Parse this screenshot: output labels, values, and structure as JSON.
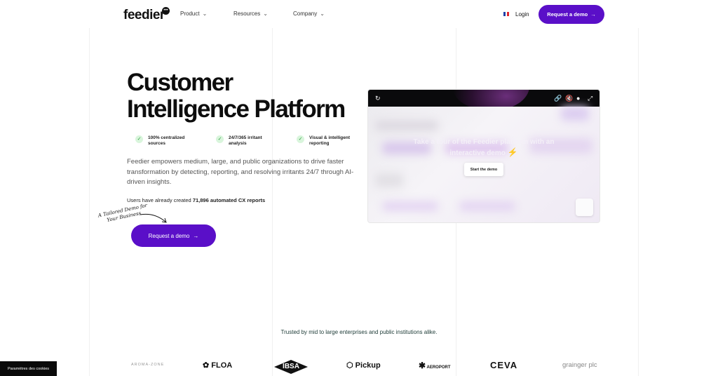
{
  "nav": {
    "logo": "feedier",
    "logo_badge": "•••",
    "items": [
      {
        "label": "Product"
      },
      {
        "label": "Resources"
      },
      {
        "label": "Company"
      }
    ],
    "login": "Login",
    "cta": "Request a demo",
    "cta_arrow": "→"
  },
  "hero": {
    "title_line1": "Customer",
    "title_line2": "Intelligence Platform",
    "features": [
      {
        "line1": "100% centralized",
        "line2": "sources"
      },
      {
        "line1": "24/7/365 irritant",
        "line2": "analysis"
      },
      {
        "line1": "Visual & intelligent",
        "line2": "reporting"
      }
    ],
    "description": "Feedier empowers medium, large, and public organizations to drive faster transformation by detecting, reporting, and resolving irritants 24/7 through AI-driven insights.",
    "users_prefix": "Users have already created ",
    "users_count": "71,896 automated CX reports",
    "hand_note": "A Tailored Demo for Your Business",
    "cta": "Request a demo",
    "cta_arrow": "→"
  },
  "demo": {
    "headline": "Take a tour of the Feedier platform with an interactive demo",
    "start_label": "Start the demo"
  },
  "trust": {
    "text": "Trusted by mid to large enterprises and public institutions alike.",
    "logos": [
      {
        "name": "AROMA-ZONE"
      },
      {
        "name": "FLOA"
      },
      {
        "name": "IBSA"
      },
      {
        "name": "Pickup"
      },
      {
        "name": "AEROPORT"
      },
      {
        "name": "CEVA"
      },
      {
        "name": "grainger plc"
      }
    ]
  },
  "cookie": {
    "label": "Paramètres des cookies"
  },
  "colors": {
    "brand": "#5a0fc8",
    "check_bg": "#d9f5dc",
    "check": "#2a9d3c"
  },
  "icons": [
    "chevron-down-icon",
    "france-flag-icon",
    "check-icon",
    "refresh-icon",
    "link-icon",
    "mute-icon",
    "chat-icon",
    "expand-icon",
    "lightning-icon"
  ]
}
